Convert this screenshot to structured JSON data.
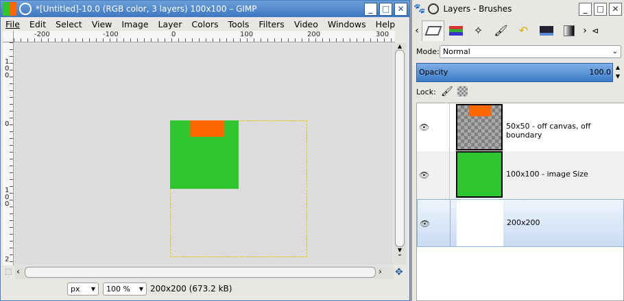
{
  "main_window": {
    "title": "*[Untitled]-10.0 (RGB color, 3 layers) 100x100 – GIMP",
    "controls": [
      "_",
      "□",
      "✕"
    ]
  },
  "menu": [
    "File",
    "Edit",
    "Select",
    "View",
    "Image",
    "Layer",
    "Colors",
    "Tools",
    "Filters",
    "Video",
    "Windows",
    "Help"
  ],
  "ruler": {
    "h_labels": [
      "-200",
      "-100",
      "0",
      "100",
      "200",
      "300"
    ],
    "v_labels": [
      "100",
      "0",
      "100",
      "2"
    ]
  },
  "status": {
    "unit": "px",
    "zoom": "100 %",
    "info": "200x200 (673.2 kB)"
  },
  "layers_window": {
    "title": "Layers - Brushes",
    "controls": [
      "_",
      "□",
      "✕"
    ],
    "mode_label": "Mode:",
    "mode_value": "Normal",
    "opacity_label": "Opacity",
    "opacity_value": "100.0",
    "lock_label": "Lock:",
    "layers": [
      {
        "name": "50x50 - off canvas, off boundary",
        "selected": false
      },
      {
        "name": "100x100 - image Size",
        "selected": false
      },
      {
        "name": "200x200",
        "selected": true
      }
    ]
  },
  "colors": {
    "green": "#30c42e",
    "orange": "#ff6600",
    "accent": "#4a8ad4"
  }
}
